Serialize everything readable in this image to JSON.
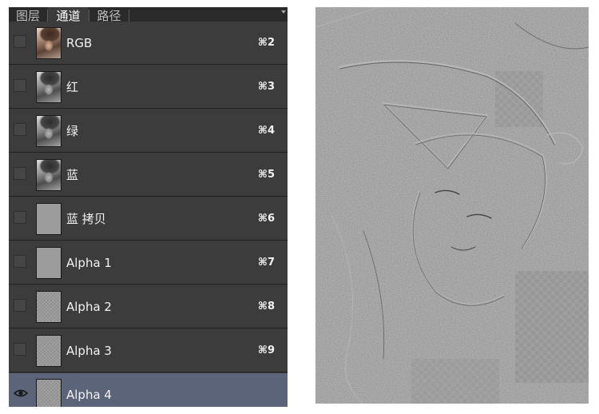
{
  "tabs": [
    {
      "label": "图层",
      "active": false
    },
    {
      "label": "通道",
      "active": true
    },
    {
      "label": "路径",
      "active": false
    }
  ],
  "channels": [
    {
      "label": "RGB",
      "shortcut": "⌘2",
      "thumbnail": "color-photo",
      "visible": false,
      "selected": false
    },
    {
      "label": "红",
      "shortcut": "⌘3",
      "thumbnail": "grayscale-photo",
      "visible": false,
      "selected": false
    },
    {
      "label": "绿",
      "shortcut": "⌘4",
      "thumbnail": "grayscale-photo",
      "visible": false,
      "selected": false
    },
    {
      "label": "蓝",
      "shortcut": "⌘5",
      "thumbnail": "grayscale-photo",
      "visible": false,
      "selected": false
    },
    {
      "label": "蓝 拷贝",
      "shortcut": "⌘6",
      "thumbnail": "flat-gray",
      "visible": false,
      "selected": false
    },
    {
      "label": "Alpha 1",
      "shortcut": "⌘7",
      "thumbnail": "flat-gray",
      "visible": false,
      "selected": false
    },
    {
      "label": "Alpha 2",
      "shortcut": "⌘8",
      "thumbnail": "high-pass-texture",
      "visible": false,
      "selected": false
    },
    {
      "label": "Alpha 3",
      "shortcut": "⌘9",
      "thumbnail": "high-pass-texture",
      "visible": false,
      "selected": false
    },
    {
      "label": "Alpha 4",
      "shortcut": "",
      "thumbnail": "high-pass-texture",
      "visible": true,
      "selected": true
    }
  ],
  "icons": {
    "visibility": "eye-icon",
    "panel_menu": "chevron-down-icon"
  },
  "colors": {
    "panel_background": "#3c3c3c",
    "tab_bar_background": "#2a2a2a",
    "selected_row": "#5b6479",
    "row_text": "#f2f2f2",
    "preview_background": "#8c8c8c"
  },
  "preview": {
    "description": "high-pass filtered grayscale image of a girl lying down"
  }
}
